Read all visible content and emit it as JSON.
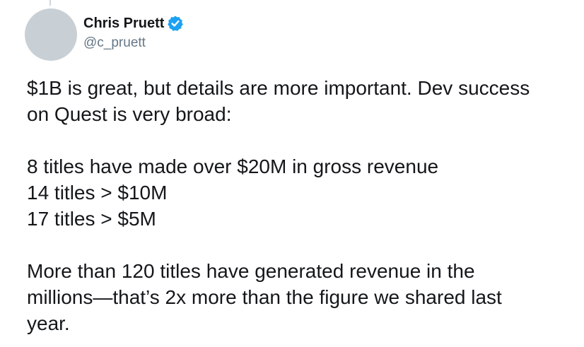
{
  "author": {
    "display_name": "Chris Pruett",
    "handle": "@c_pruett",
    "verified": true,
    "verified_icon": "verified-badge-icon",
    "accent_color": "#1da1f2"
  },
  "tweet": {
    "paragraphs": [
      [
        "$1B is great, but details are more important. Dev success",
        "on Quest is very broad:"
      ],
      [
        "8 titles have made over $20M in gross revenue",
        "14 titles > $10M",
        "17 titles > $5M"
      ],
      [
        "More than 120 titles have generated revenue in the",
        "millions—that’s 2x more than the figure we shared last",
        "year."
      ]
    ]
  }
}
